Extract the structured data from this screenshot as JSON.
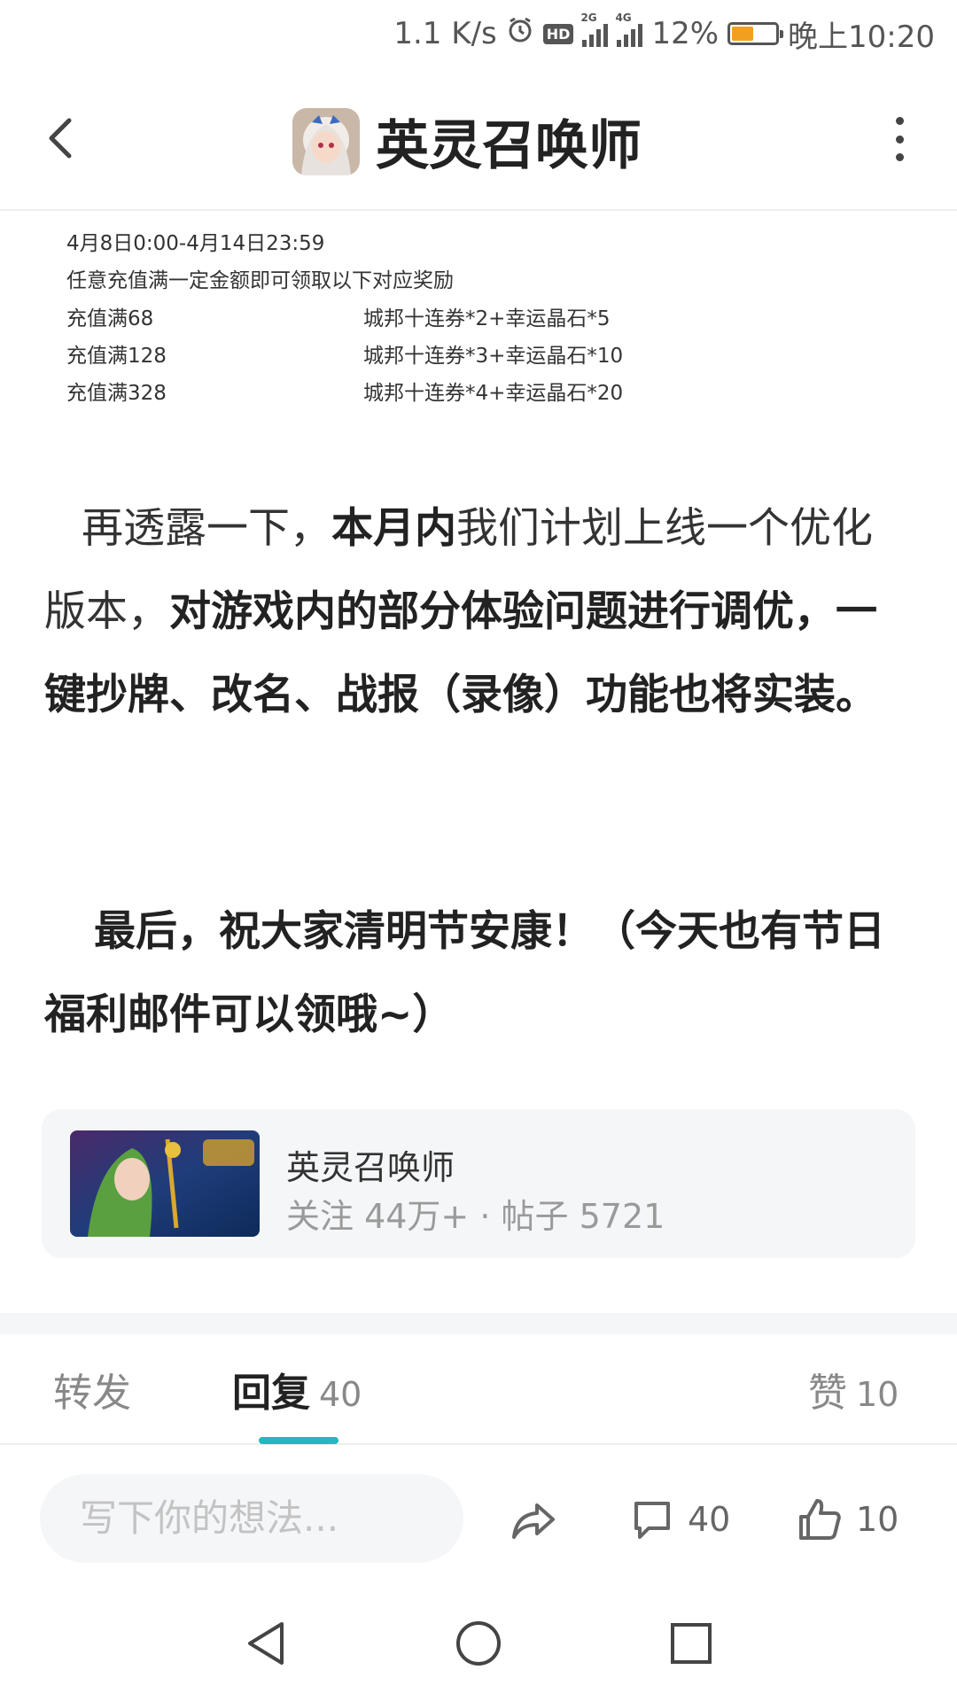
{
  "status_bar": {
    "speed": "1.1 K/s",
    "hd": "HD",
    "sim1": "2G",
    "sim2": "4G",
    "battery": "12%",
    "time": "晚上10:20",
    "icons": [
      "alarm-icon",
      "hd-icon",
      "signal-icon",
      "battery-icon"
    ]
  },
  "header": {
    "title": "英灵召唤师",
    "icons": [
      "back-arrow-icon",
      "app-avatar-icon",
      "more-vertical-icon"
    ]
  },
  "embed_image": {
    "date_range": "4月8日0:00-4月14日23:59",
    "intro": "任意充值满一定金额即可领取以下对应奖励",
    "rows": [
      {
        "tier": "充值满68",
        "reward": "城邦十连券*2+幸运晶石*5"
      },
      {
        "tier": "充值满128",
        "reward": "城邦十连券*3+幸运晶石*10"
      },
      {
        "tier": "充值满328",
        "reward": "城邦十连券*4+幸运晶石*20"
      }
    ]
  },
  "article": {
    "p1": {
      "a": "再透露一下，",
      "b": "本月内",
      "c": "我们计划上线一个优化版本，",
      "d": "对游戏内的部分体验问题进行调优，一键抄牌、改名、战报（录像）功能也将实装。"
    },
    "p2": "最后，祝大家清明节安康！（今天也有节日福利邮件可以领哦~）"
  },
  "forum_card": {
    "name": "英灵召唤师",
    "stats": "关注 44万+ · 帖子 5721"
  },
  "tabs": {
    "repost": "转发",
    "reply": "回复",
    "reply_count": "40",
    "like": "赞",
    "like_count": "10"
  },
  "action_bar": {
    "placeholder": "写下你的想法...",
    "comment_count": "40",
    "like_count": "10"
  },
  "colors": {
    "accent": "#22b8c0",
    "text": "#333333",
    "muted": "#9a9a9a",
    "card_bg": "#f5f6f8"
  }
}
